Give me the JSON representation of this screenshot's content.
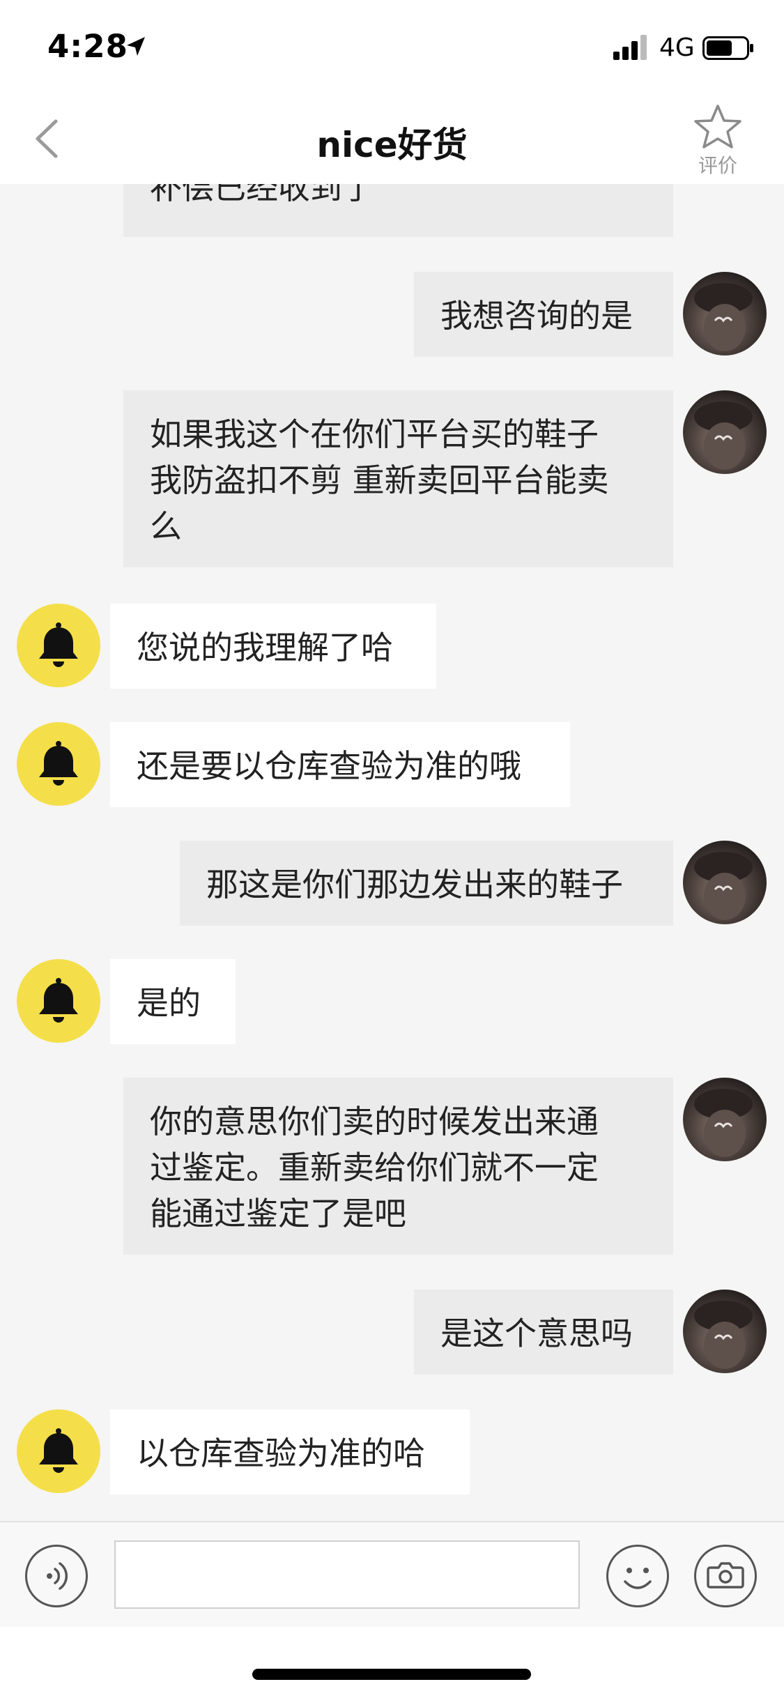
{
  "status_bar": {
    "time": "4:28",
    "network": "4G",
    "icons": [
      "location-arrow-icon",
      "signal-bars-icon",
      "battery-icon"
    ]
  },
  "nav": {
    "title": "nice好货",
    "back_icon": "chevron-left-icon",
    "rate_label": "评价",
    "rate_icon": "star-outline-icon"
  },
  "messages": [
    {
      "sender": "user",
      "lines": [
        "补偿已经收到了"
      ]
    },
    {
      "sender": "user",
      "lines": [
        "我想咨询的是"
      ]
    },
    {
      "sender": "user",
      "lines": [
        "如果我这个在你们平台买的鞋子",
        "我防盗扣不剪 重新卖回平台能卖",
        "么"
      ]
    },
    {
      "sender": "bot",
      "lines": [
        "您说的我理解了哈"
      ]
    },
    {
      "sender": "bot",
      "lines": [
        "还是要以仓库查验为准的哦"
      ]
    },
    {
      "sender": "user",
      "lines": [
        "那这是你们那边发出来的鞋子"
      ]
    },
    {
      "sender": "bot",
      "lines": [
        "是的"
      ]
    },
    {
      "sender": "user",
      "lines": [
        "你的意思你们卖的时候发出来通",
        "过鉴定。重新卖给你们就不一定",
        "能通过鉴定了是吧"
      ]
    },
    {
      "sender": "user",
      "lines": [
        "是这个意思吗"
      ]
    },
    {
      "sender": "bot",
      "lines": [
        "以仓库查验为准的哈"
      ]
    }
  ],
  "input_bar": {
    "value": "",
    "icons": [
      "voice-icon",
      "emoji-icon",
      "camera-icon"
    ]
  },
  "colors": {
    "bot_avatar": "#f4df4a",
    "user_bubble": "#ebebeb",
    "bot_bubble": "#ffffff",
    "background": "#f5f5f5"
  }
}
